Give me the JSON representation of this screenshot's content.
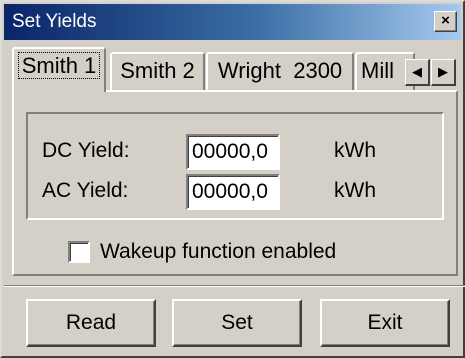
{
  "window": {
    "title": "Set Yields",
    "close_glyph": "×"
  },
  "tabs": [
    {
      "label": "Smith 1",
      "active": true
    },
    {
      "label": "Smith 2",
      "active": false
    },
    {
      "label": "Wright  2300",
      "active": false
    },
    {
      "label": "Mill",
      "active": false
    }
  ],
  "tab_scroll": {
    "left_glyph": "◀",
    "right_glyph": "▶"
  },
  "yields": {
    "dc": {
      "label": "DC Yield:",
      "value": "00000,0",
      "unit": "kWh"
    },
    "ac": {
      "label": "AC Yield:",
      "value": "00000,0",
      "unit": "kWh"
    }
  },
  "wakeup": {
    "label": "Wakeup function enabled",
    "checked": false
  },
  "buttons": {
    "read": "Read",
    "set": "Set",
    "exit": "Exit"
  },
  "colors": {
    "face": "#d4d0c8",
    "title_start": "#0a246a",
    "title_end": "#a6caf0",
    "title_text": "#ffffff"
  }
}
